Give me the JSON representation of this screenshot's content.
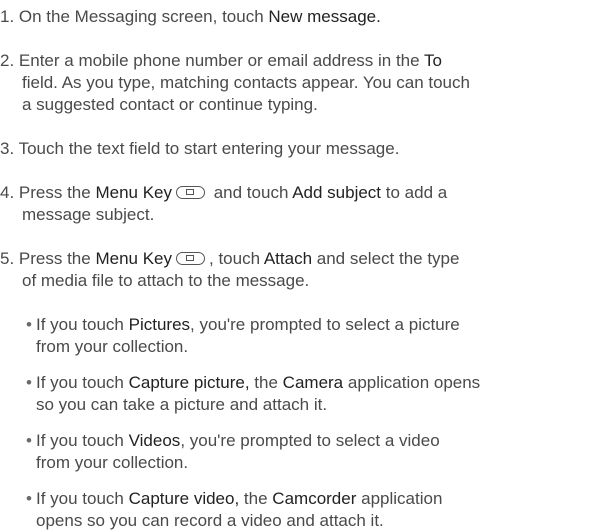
{
  "steps": [
    {
      "num": "1.",
      "lines": [
        {
          "pre": " On the Messaging screen, touch ",
          "em": "New message.",
          "post": ""
        }
      ]
    },
    {
      "num": "2.",
      "lines": [
        {
          "pre": " Enter a mobile phone number or email address in the ",
          "em": "To",
          "post": ""
        },
        {
          "text": "field. As you type, matching contacts appear. You can touch"
        },
        {
          "text": "a suggested contact or continue typing."
        }
      ]
    },
    {
      "num": "3.",
      "lines": [
        {
          "text": " Touch the text field to start entering your message."
        }
      ]
    },
    {
      "num": "4.",
      "l1_pre": " Press the ",
      "l1_em1": "Menu Key",
      "l1_mid": " and touch ",
      "l1_em2": "Add subject",
      "l1_post": " to add a",
      "l2": "message subject."
    },
    {
      "num": "5.",
      "l1_pre": " Press the ",
      "l1_em1": "Menu Key",
      "l1_mid": ", touch ",
      "l1_em2": "Attach",
      "l1_post": " and select the type",
      "l2": "of media file to attach to the message."
    }
  ],
  "bullets": [
    {
      "l1_pre": "If you touch ",
      "l1_em": "Pictures",
      "l1_post": ", you're prompted to select a picture",
      "l2": "from your collection."
    },
    {
      "l1_pre": "If you touch ",
      "l1_em": "Capture picture,",
      "l1_mid": " the ",
      "l1_em2": "Camera",
      "l1_post": " application opens",
      "l2": "so you can take a picture and attach it."
    },
    {
      "l1_pre": "If you touch ",
      "l1_em": "Videos",
      "l1_post": ", you're prompted to select a video",
      "l2": "from your collection."
    },
    {
      "l1_pre": "If you touch ",
      "l1_em": "Capture video,",
      "l1_mid": " the ",
      "l1_em2": "Camcorder",
      "l1_post": " application",
      "l2": "opens so you can record a video and attach it."
    }
  ],
  "bullet_glyph": "•",
  "icons": {
    "menu_key": "menu-key-icon"
  }
}
